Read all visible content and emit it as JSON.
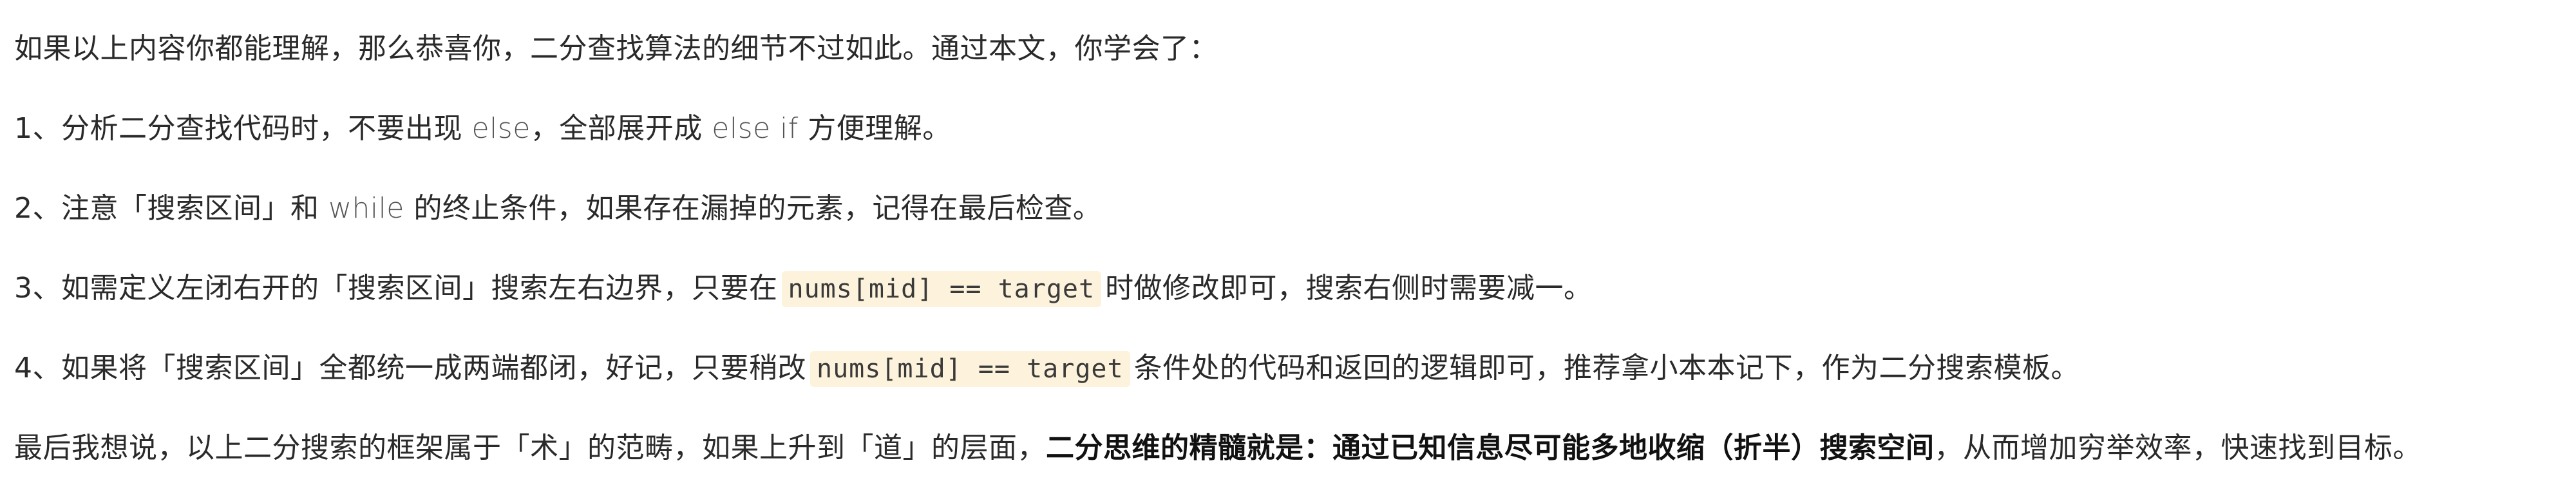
{
  "paragraphs": {
    "p1": "如果以上内容你都能理解，那么恭喜你，二分查找算法的细节不过如此。通过本文，你学会了：",
    "p2": {
      "a": "1、分析二分查找代码时，不要出现 ",
      "b": "else",
      "c": "，全部展开成 ",
      "d": "else if",
      "e": " 方便理解。"
    },
    "p3": {
      "a": "2、注意「搜索区间」和 ",
      "b": "while",
      "c": " 的终止条件，如果存在漏掉的元素，记得在最后检查。"
    },
    "p4": {
      "a": "3、如需定义左闭右开的「搜索区间」搜索左右边界，只要在",
      "code": "nums[mid] == target",
      "c": "时做修改即可，搜索右侧时需要减一。"
    },
    "p5": {
      "a": "4、如果将「搜索区间」全都统一成两端都闭，好记，只要稍改",
      "code": "nums[mid] == target",
      "c": "条件处的代码和返回的逻辑即可，推荐拿小本本记下，作为二分搜索模板。"
    },
    "p6": {
      "a": "最后我想说，以上二分搜索的框架属于「术」的范畴，如果上升到「道」的层面，",
      "bold": "二分思维的精髓就是：通过已知信息尽可能多地收缩（折半）搜索空间",
      "c": "，从而增加穷举效率，快速找到目标。"
    }
  }
}
